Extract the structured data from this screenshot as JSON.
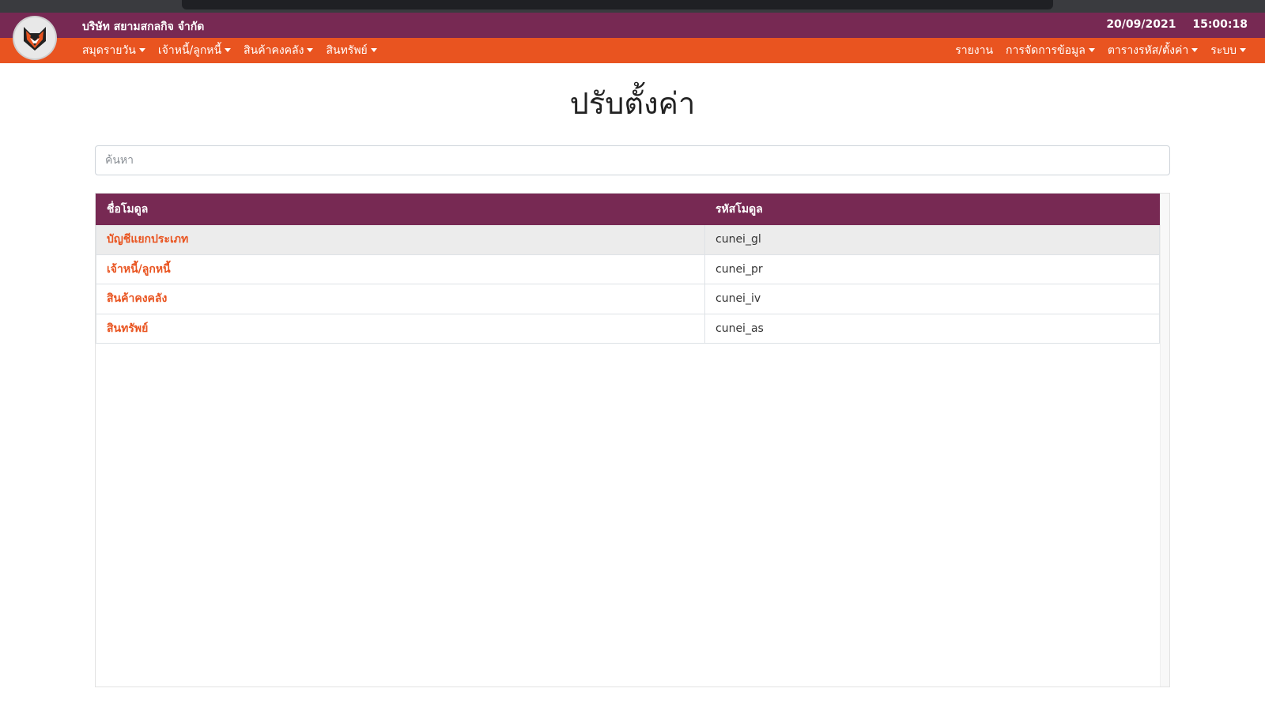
{
  "header": {
    "company_name": "บริษัท สยามสกลกิจ จำกัด",
    "date": "20/09/2021",
    "time": "15:00:18",
    "logo_icon": "fox-logo-icon"
  },
  "nav": {
    "left": [
      {
        "label": "สมุดรายวัน",
        "dropdown": true
      },
      {
        "label": "เจ้าหนี้/ลูกหนี้",
        "dropdown": true
      },
      {
        "label": "สินค้าคงคลัง",
        "dropdown": true
      },
      {
        "label": "สินทรัพย์",
        "dropdown": true
      }
    ],
    "right": [
      {
        "label": "รายงาน",
        "dropdown": false
      },
      {
        "label": "การจัดการข้อมูล",
        "dropdown": true
      },
      {
        "label": "ตารางรหัส/ตั้งค่า",
        "dropdown": true
      },
      {
        "label": "ระบบ",
        "dropdown": true
      }
    ]
  },
  "page": {
    "title": "ปรับตั้งค่า",
    "search_placeholder": "ค้นหา",
    "search_value": ""
  },
  "table": {
    "columns": [
      "ชื่อโมดูล",
      "รหัสโมดูล"
    ],
    "rows": [
      {
        "name": "บัญชีแยกประเภท",
        "code": "cunei_gl"
      },
      {
        "name": "เจ้าหนี้/ลูกหนี้",
        "code": "cunei_pr"
      },
      {
        "name": "สินค้าคงคลัง",
        "code": "cunei_iv"
      },
      {
        "name": "สินทรัพย์",
        "code": "cunei_as"
      }
    ]
  },
  "colors": {
    "purple": "#772953",
    "orange": "#e95420"
  }
}
